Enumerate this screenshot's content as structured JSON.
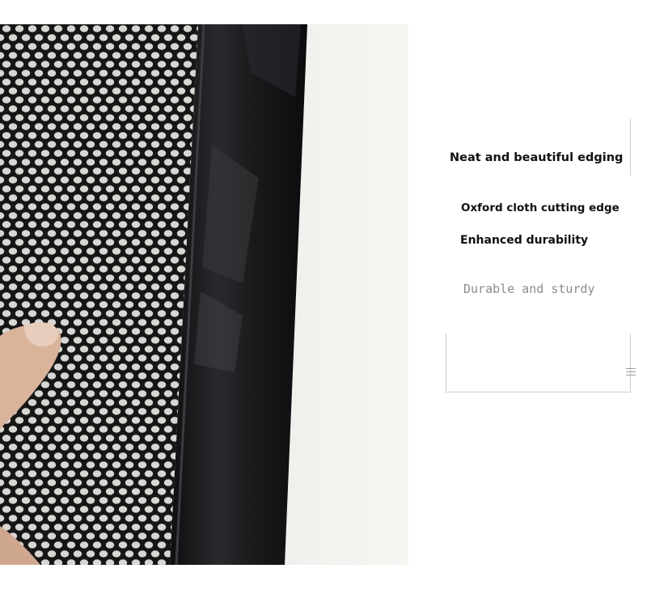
{
  "photo": {
    "description_icon": "mesh-fabric-edge-photo",
    "colors": {
      "background": "#f1f0ed",
      "mesh": "#141414",
      "oxford_band": "#1c1c1e",
      "band_highlight": "#3a3a3e",
      "skin": "#d9b39a"
    }
  },
  "callout": {
    "caption_1": "Neat and beautiful edging",
    "caption_2": "Oxford cloth cutting edge",
    "caption_3": "Enhanced durability",
    "caption_4": "Durable and sturdy"
  },
  "grip_icon": "menu-grip-icon"
}
